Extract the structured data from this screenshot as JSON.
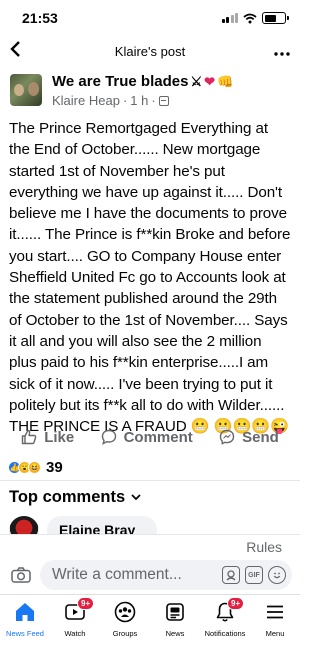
{
  "status_bar": {
    "time": "21:53"
  },
  "header": {
    "title": "Klaire's post",
    "back_icon": "chevron-left-icon",
    "more_icon": "more-dots-icon"
  },
  "post": {
    "group_name": "We are True blades",
    "group_emojis": [
      "⚔",
      "❤",
      "👊"
    ],
    "author": "Klaire Heap",
    "time_ago": "1 h",
    "separator": "·",
    "body": "The Prince Remortgaged Everything at the End of October...... New mortgage started 1st of November he's put everything we have up against it..... Don't believe me I have the documents to prove it...... The Prince is f**kin Broke and before you start.... GO to Company House enter Sheffield United Fc go to Accounts look at the statement published around the 29th  of October to the 1st of November.... Says it all and you will also see the 2 million plus paid to his f**kin enterprise.....I am sick of it now..... I've been trying to put it politely but its f**k all to do with Wilder...... THE PRINCE IS A FRAUD 😬 😬😬😬😜"
  },
  "actions": {
    "like": "Like",
    "comment": "Comment",
    "send": "Send"
  },
  "reactions": {
    "count": "39",
    "types": [
      "like",
      "wow",
      "laugh"
    ]
  },
  "comments": {
    "section_title": "Top comments",
    "first_commenter": "Elaine Bray",
    "rules": "Rules",
    "composer_placeholder": "Write a comment...",
    "gif_label": "GIF"
  },
  "tabbar": [
    {
      "label": "News Feed",
      "icon": "home-icon",
      "active": true,
      "badge": ""
    },
    {
      "label": "Watch",
      "icon": "watch-icon",
      "active": false,
      "badge": "9+"
    },
    {
      "label": "Groups",
      "icon": "groups-icon",
      "active": false,
      "badge": ""
    },
    {
      "label": "News",
      "icon": "news-icon",
      "active": false,
      "badge": ""
    },
    {
      "label": "Notifications",
      "icon": "bell-icon",
      "active": false,
      "badge": "9+"
    },
    {
      "label": "Menu",
      "icon": "menu-icon",
      "active": false,
      "badge": ""
    }
  ],
  "colors": {
    "accent": "#1877f2",
    "badge": "#e41e3f",
    "secondary_text": "#65676b"
  }
}
